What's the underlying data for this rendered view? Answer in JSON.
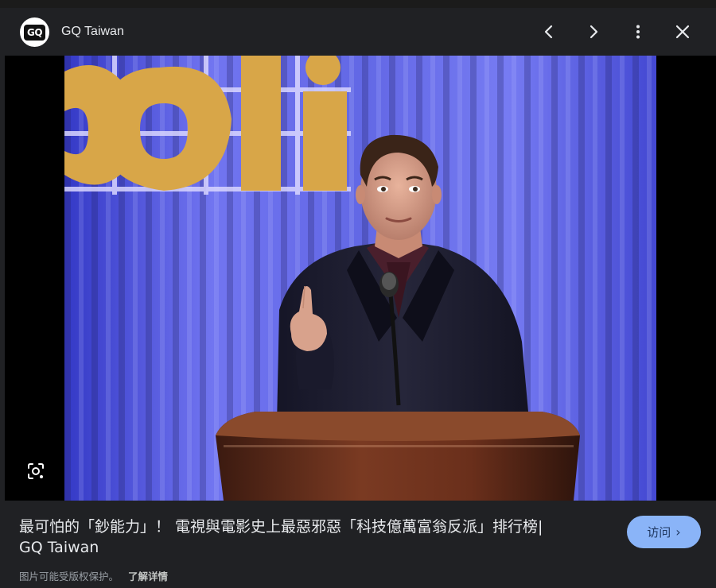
{
  "header": {
    "logo_text": "GQ",
    "site_name": "GQ Taiwan",
    "icons": [
      "chevron-left-icon",
      "chevron-right-icon",
      "more-vert-icon",
      "close-icon"
    ]
  },
  "image": {
    "backdrop_sign_text": "oli",
    "lens_icon": "lens-search-icon"
  },
  "caption": {
    "title_line1": "最可怕的「鈔能力」！ 電視與電影史上最惡邪惡「科技億萬富翁反派」排行榜|",
    "title_line2": "GQ Taiwan",
    "copyright_notice": "图片可能受版权保护。",
    "learn_more": "了解详情",
    "visit_label": "访问",
    "visit_chevron": "›"
  },
  "colors": {
    "background": "#202124",
    "text": "#e8eaed",
    "accent": "#8ab4f8"
  }
}
